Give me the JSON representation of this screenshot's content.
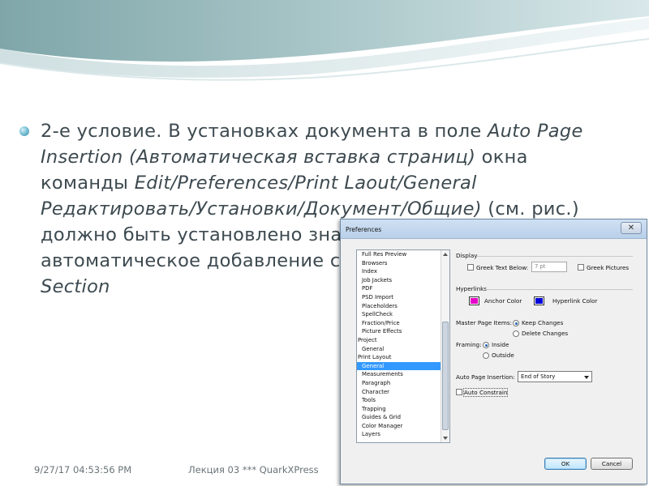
{
  "slide": {
    "bullet": {
      "p1": "2-е условие. В установках документа в поле ",
      "p2": "Auto Page Insertion (Автоматическая вставка страниц)",
      "p3": " окна команды ",
      "p4": "Edit/Preferences/Print Laout/General Редактировать/Установки/Документ/Общие)",
      "p5": " (см. рис.) должно быть установлено значение, разрешающее автоматическое добавление страниц: ",
      "p6": "End of Story, End of Section"
    },
    "footer": {
      "date": "9/27/17 04:53:56 PM",
      "center": "Лекция 03  ***  QuarkXPress"
    },
    "colors": {
      "text": "#3d4a50",
      "accent": "#7cc3d6"
    }
  },
  "dialog": {
    "title": "Preferences",
    "close_glyph": "✕",
    "tree": [
      {
        "label": "Full Res Preview",
        "level": 1,
        "selected": false
      },
      {
        "label": "Browsers",
        "level": 1,
        "selected": false
      },
      {
        "label": "Index",
        "level": 1,
        "selected": false
      },
      {
        "label": "Job Jackets",
        "level": 1,
        "selected": false
      },
      {
        "label": "PDF",
        "level": 1,
        "selected": false
      },
      {
        "label": "PSD Import",
        "level": 1,
        "selected": false
      },
      {
        "label": "Placeholders",
        "level": 1,
        "selected": false
      },
      {
        "label": "SpellCheck",
        "level": 1,
        "selected": false
      },
      {
        "label": "Fraction/Price",
        "level": 1,
        "selected": false
      },
      {
        "label": "Picture Effects",
        "level": 1,
        "selected": false
      },
      {
        "label": "Project",
        "level": 0,
        "selected": false
      },
      {
        "label": "General",
        "level": 1,
        "selected": false
      },
      {
        "label": "Print Layout",
        "level": 0,
        "selected": false
      },
      {
        "label": "General",
        "level": 1,
        "selected": true
      },
      {
        "label": "Measurements",
        "level": 1,
        "selected": false
      },
      {
        "label": "Paragraph",
        "level": 1,
        "selected": false
      },
      {
        "label": "Character",
        "level": 1,
        "selected": false
      },
      {
        "label": "Tools",
        "level": 1,
        "selected": false
      },
      {
        "label": "Trapping",
        "level": 1,
        "selected": false
      },
      {
        "label": "Guides & Grid",
        "level": 1,
        "selected": false
      },
      {
        "label": "Color Manager",
        "level": 1,
        "selected": false
      },
      {
        "label": "Layers",
        "level": 1,
        "selected": false
      }
    ],
    "display": {
      "label": "Display",
      "greek_text_below": "Greek Text Below:",
      "greek_value": "7 pt",
      "greek_pictures": "Greek Pictures"
    },
    "hyperlinks": {
      "label": "Hyperlinks",
      "anchor_color": "Anchor Color",
      "anchor_swatch": "#e600c8",
      "hyperlink_color": "Hyperlink Color",
      "hyperlink_swatch": "#0000d8"
    },
    "master_page_items": {
      "label": "Master Page Items:",
      "keep_changes": "Keep Changes",
      "delete_changes": "Delete Changes",
      "selected": "keep"
    },
    "framing": {
      "label": "Framing:",
      "inside": "Inside",
      "outside": "Outside",
      "selected": "inside"
    },
    "auto_page_insertion": {
      "label": "Auto Page Insertion:",
      "value": "End of Story"
    },
    "auto_constrain": {
      "label": "Auto Constrain",
      "checked": false
    },
    "buttons": {
      "ok": "OK",
      "cancel": "Cancel"
    }
  }
}
